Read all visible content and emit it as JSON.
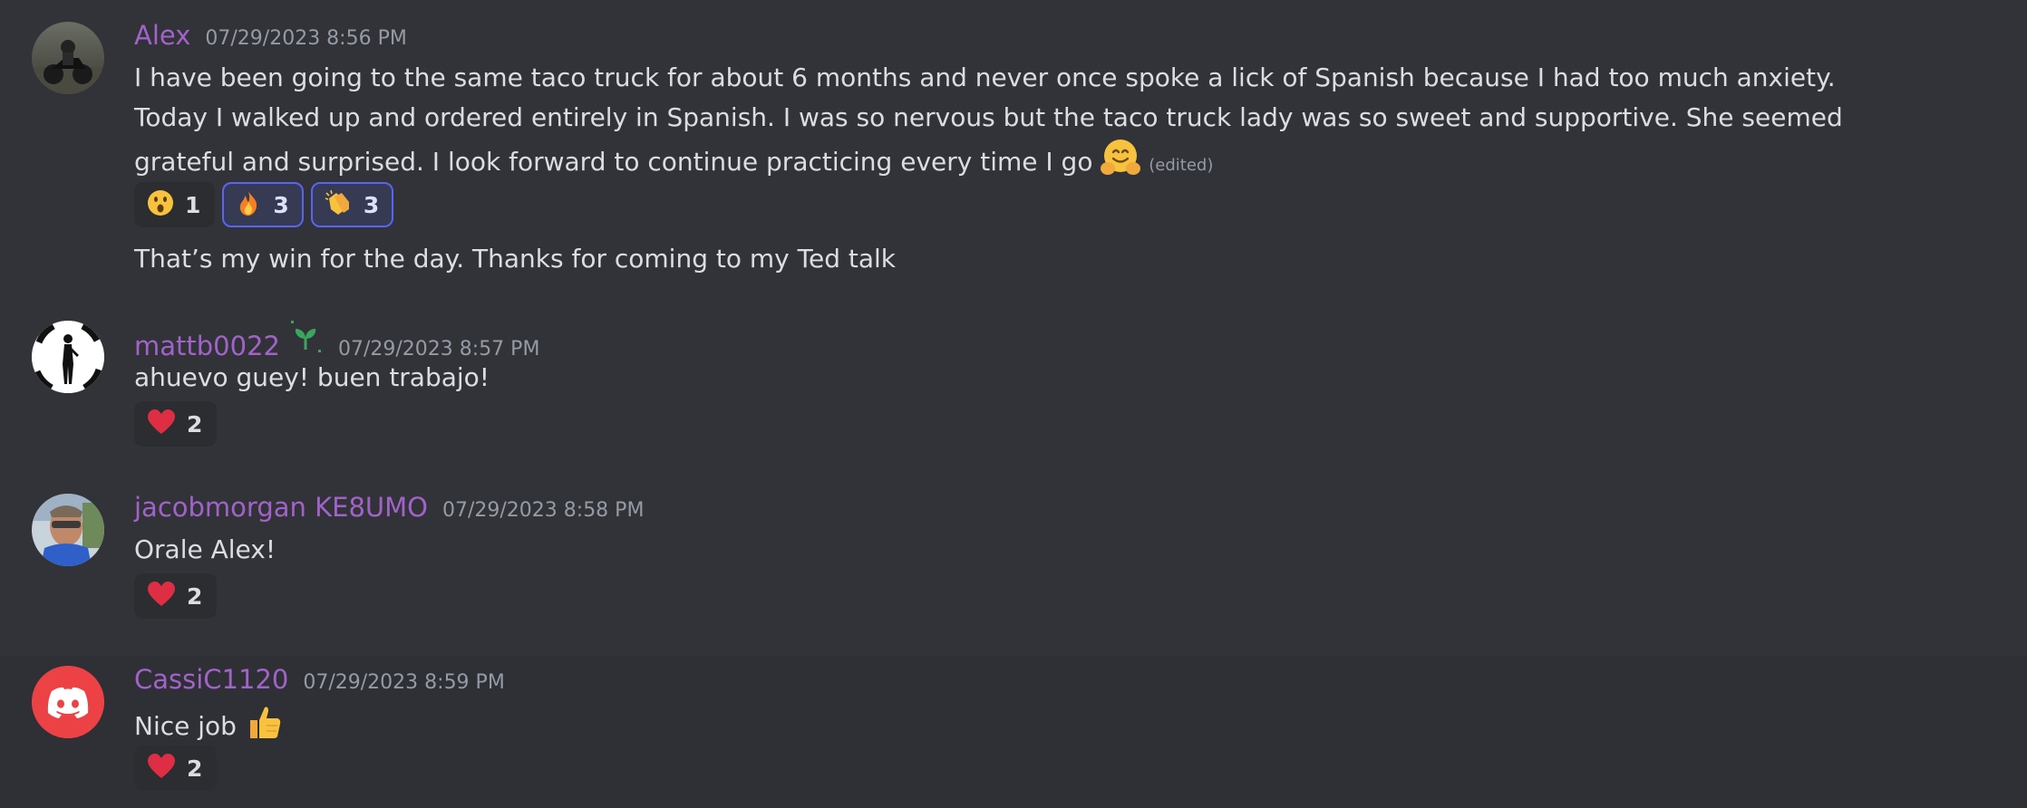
{
  "messages": [
    {
      "username": "Alex",
      "timestamp": "07/29/2023 8:56 PM",
      "text": "I have been going to the same taco truck for about 6 months and never once spoke a lick of Spanish because I had too much anxiety. Today I walked up and ordered entirely in Spanish. I was so nervous but the taco truck lady was so sweet and supportive. She seemed grateful and surprised. I look forward to continue practicing every time I go",
      "inline_emoji": "hugging-face-emoji",
      "edited": "(edited)",
      "reactions": [
        {
          "emoji": "astonished-face",
          "count": "1",
          "me": false
        },
        {
          "emoji": "fire",
          "count": "3",
          "me": true
        },
        {
          "emoji": "clapping-hands",
          "count": "3",
          "me": true
        }
      ],
      "followup": "That’s my win for the day. Thanks for coming to my Ted talk"
    },
    {
      "username": "mattb0022",
      "badge": "sprout-badge-icon",
      "timestamp": "07/29/2023 8:57 PM",
      "text": "ahuevo guey! buen trabajo!",
      "reactions": [
        {
          "emoji": "red-heart",
          "count": "2",
          "me": false
        }
      ]
    },
    {
      "username": "jacobmorgan KE8UMO",
      "timestamp": "07/29/2023 8:58 PM",
      "text": "Orale Alex!",
      "reactions": [
        {
          "emoji": "red-heart",
          "count": "2",
          "me": false
        }
      ]
    },
    {
      "username": "CassiC1120",
      "timestamp": "07/29/2023 8:59 PM",
      "text": "Nice job",
      "inline_emoji": "thumbs-up-emoji",
      "reactions": [
        {
          "emoji": "red-heart",
          "count": "2",
          "me": false
        }
      ]
    }
  ],
  "colors": {
    "background": "#313338",
    "username": "#a263c9",
    "timestamp": "#949ba4",
    "text": "#dbdee1",
    "reaction_bg": "#2b2d31",
    "reaction_me_border": "#5865f2",
    "discord_avatar": "#ed4245"
  }
}
